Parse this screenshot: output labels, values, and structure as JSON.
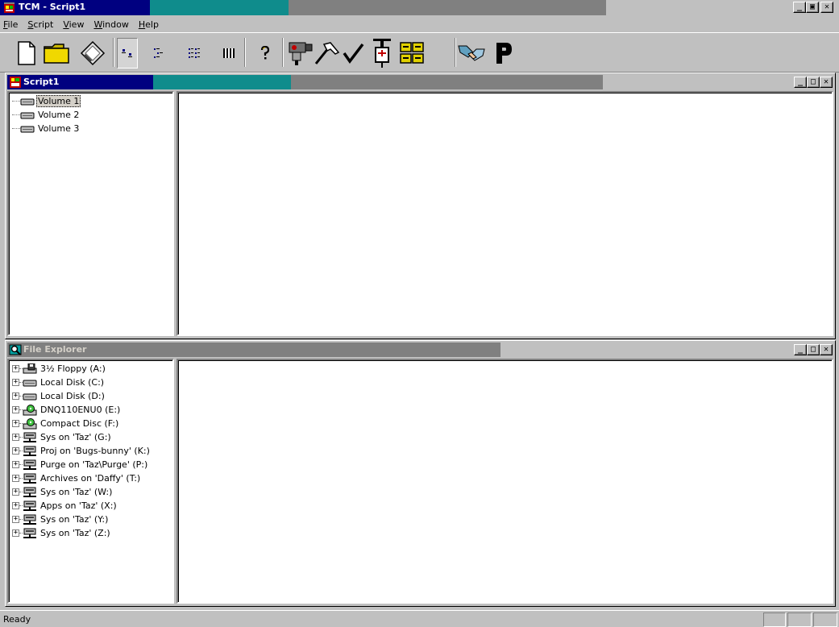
{
  "app": {
    "title": "TCM - Script1",
    "colors": {
      "active_title": "#000080",
      "title_mid": "#0f8c8c",
      "inactive_title": "#808080",
      "face": "#c0c0c0"
    }
  },
  "caption_buttons": {
    "minimize": "_",
    "restore": "▣",
    "close": "✕"
  },
  "child_caption_buttons": {
    "minimize": "_",
    "maximize": "□",
    "close": "✕"
  },
  "menu": [
    {
      "label": "File",
      "mnemonic": "F",
      "rest": "ile"
    },
    {
      "label": "Script",
      "mnemonic": "S",
      "rest": "cript"
    },
    {
      "label": "View",
      "mnemonic": "V",
      "rest": "iew"
    },
    {
      "label": "Window",
      "mnemonic": "W",
      "rest": "indow"
    },
    {
      "label": "Help",
      "mnemonic": "H",
      "rest": "elp"
    }
  ],
  "toolbar": {
    "buttons": [
      {
        "name": "new-document-button",
        "icon": "new-page-icon"
      },
      {
        "name": "open-folder-button",
        "icon": "open-folder-icon"
      },
      {
        "name": "save-disk-button",
        "icon": "diskette-icon"
      },
      {
        "name": "large-icons-view-button",
        "icon": "large-icons-view-icon",
        "pressed": true
      },
      {
        "name": "small-icons-view-button",
        "icon": "small-icons-view-icon"
      },
      {
        "name": "list-view-button",
        "icon": "list-view-icon"
      },
      {
        "name": "details-view-button",
        "icon": "details-view-icon"
      },
      {
        "name": "help-button",
        "icon": "question-mark-icon"
      },
      {
        "name": "camera-button",
        "icon": "video-camera-icon"
      },
      {
        "name": "build-button",
        "icon": "hammer-icon"
      },
      {
        "name": "verify-button",
        "icon": "checkmark-icon"
      },
      {
        "name": "inject-button",
        "icon": "syringe-icon"
      },
      {
        "name": "cabinet-button",
        "icon": "file-cabinet-icon"
      },
      {
        "name": "handshake-button",
        "icon": "handshake-icon"
      },
      {
        "name": "park-button",
        "icon": "p-letter-icon"
      }
    ]
  },
  "script_window": {
    "title": "Script1",
    "volumes": [
      "Volume 1",
      "Volume 2",
      "Volume 3"
    ],
    "selected": "Volume 1"
  },
  "explorer_window": {
    "title": "File Explorer",
    "drives": [
      {
        "label": "3½ Floppy (A:)",
        "icon": "floppy-drive-icon"
      },
      {
        "label": "Local Disk (C:)",
        "icon": "hard-disk-icon"
      },
      {
        "label": "Local Disk (D:)",
        "icon": "hard-disk-icon"
      },
      {
        "label": "DNQ110ENU0 (E:)",
        "icon": "cd-drive-icon"
      },
      {
        "label": "Compact Disc (F:)",
        "icon": "cd-drive-icon"
      },
      {
        "label": "Sys on 'Taz' (G:)",
        "icon": "network-drive-icon"
      },
      {
        "label": "Proj on 'Bugs-bunny' (K:)",
        "icon": "network-drive-icon"
      },
      {
        "label": "Purge on 'Taz\\Purge' (P:)",
        "icon": "network-drive-icon"
      },
      {
        "label": "Archives on 'Daffy' (T:)",
        "icon": "network-drive-icon"
      },
      {
        "label": "Sys on 'Taz' (W:)",
        "icon": "network-drive-icon"
      },
      {
        "label": "Apps on 'Taz' (X:)",
        "icon": "network-drive-icon"
      },
      {
        "label": "Sys on 'Taz' (Y:)",
        "icon": "network-drive-icon"
      },
      {
        "label": "Sys on 'Taz' (Z:)",
        "icon": "network-drive-icon"
      }
    ]
  },
  "status": {
    "text": "Ready"
  }
}
